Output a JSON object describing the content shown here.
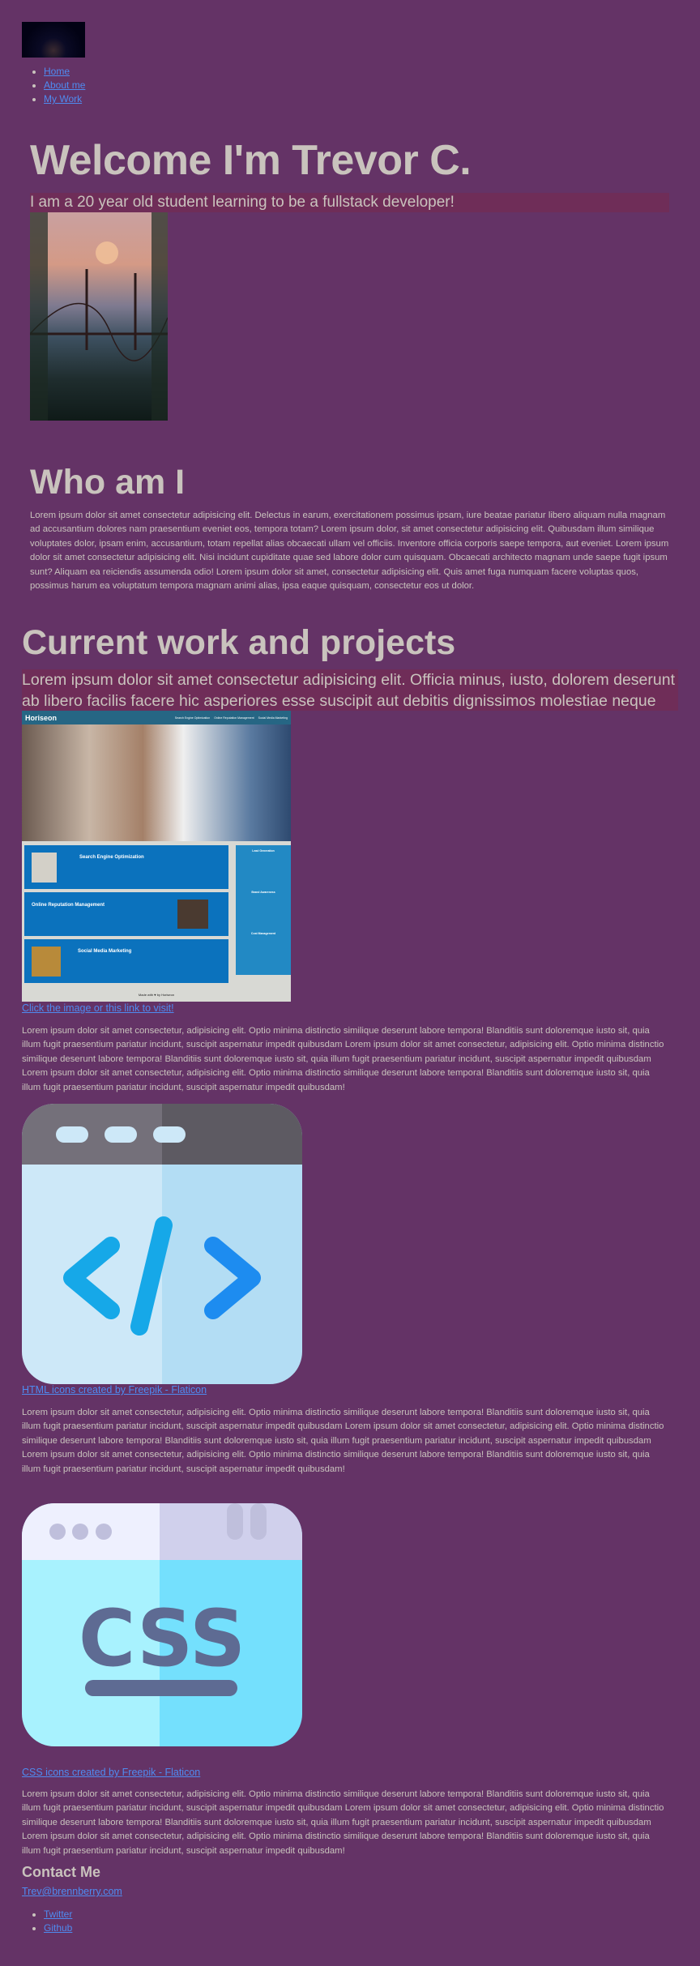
{
  "header": {
    "nav": [
      {
        "label": "Home"
      },
      {
        "label": "About me"
      },
      {
        "label": "My Work"
      }
    ]
  },
  "hero": {
    "title": "Welcome I'm Trevor C.",
    "subtitle": "I am a 20 year old student learning to be a fullstack developer!"
  },
  "about": {
    "title": "Who am I",
    "text": "Lorem ipsum dolor sit amet consectetur adipisicing elit. Delectus in earum, exercitationem possimus ipsam, iure beatae pariatur libero aliquam nulla magnam ad accusantium dolores nam praesentium eveniet eos, tempora totam? Lorem ipsum dolor, sit amet consectetur adipisicing elit. Quibusdam illum similique voluptates dolor, ipsam enim, accusantium, totam repellat alias obcaecati ullam vel officiis. Inventore officia corporis saepe tempora, aut eveniet. Lorem ipsum dolor sit amet consectetur adipisicing elit. Nisi incidunt cupiditate quae sed labore dolor cum quisquam. Obcaecati architecto magnam unde saepe fugit ipsum sunt? Aliquam ea reiciendis assumenda odio! Lorem ipsum dolor sit amet, consectetur adipisicing elit. Quis amet fuga numquam facere voluptas quos, possimus harum ea voluptatum tempora magnam animi alias, ipsa eaque quisquam, consectetur eos ut dolor."
  },
  "work": {
    "title": "Current work and projects",
    "intro": "Lorem ipsum dolor sit amet consectetur adipisicing elit. Officia minus, iusto, dolorem deserunt ab libero facilis facere hic asperiores esse suscipit aut debitis dignissimos molestiae neque deleniti odio natus sint!",
    "project": {
      "brand": "Horiseon",
      "nav": [
        "Search Engine Optimization",
        "Online Reputation Management",
        "Social Media Marketing"
      ],
      "cards": [
        "Search Engine Optimization",
        "Online Reputation Management",
        "Social Media Marketing"
      ],
      "side": [
        "Lead Generation",
        "Brand Awareness",
        "Cost Management"
      ],
      "footer": "Made with ♥ by Horiseon",
      "link": "Click the image or this link to visit!"
    },
    "paragraph": "Lorem ipsum dolor sit amet consectetur, adipisicing elit. Optio minima distinctio similique deserunt labore tempora! Blanditiis sunt doloremque iusto sit, quia illum fugit praesentium pariatur incidunt, suscipit aspernatur impedit quibusdam Lorem ipsum dolor sit amet consectetur, adipisicing elit. Optio minima distinctio similique deserunt labore tempora! Blanditiis sunt doloremque iusto sit, quia illum fugit praesentium pariatur incidunt, suscipit aspernatur impedit quibusdam Lorem ipsum dolor sit amet consectetur, adipisicing elit. Optio minima distinctio similique deserunt labore tempora! Blanditiis sunt doloremque iusto sit, quia illum fugit praesentium pariatur incidunt, suscipit aspernatur impedit quibusdam!",
    "html_credit": "HTML icons created by Freepik - Flaticon",
    "css_credit": "CSS icons created by Freepik - Flaticon",
    "css_icon_text": "CSS"
  },
  "contact": {
    "title": "Contact Me",
    "email": "Trev@brennberry.com",
    "links": [
      {
        "label": "Twitter"
      },
      {
        "label": "Github"
      }
    ]
  },
  "colors": {
    "background": "#643366",
    "band": "#6f2d58",
    "text": "#c9c3bd",
    "link": "#4f8bf0"
  }
}
